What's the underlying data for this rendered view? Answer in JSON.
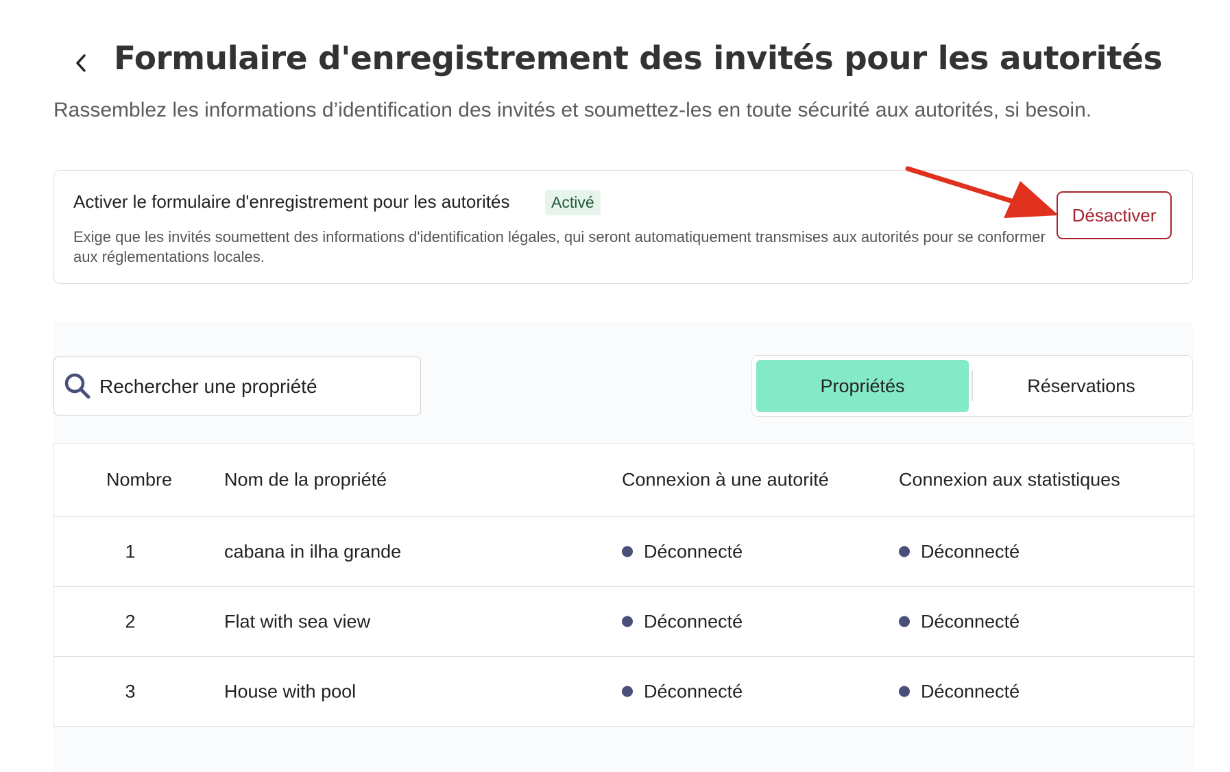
{
  "header": {
    "back_icon": "chevron-left-icon",
    "title": "Formulaire d'enregistrement des invités pour les autorités",
    "subtitle": "Rassemblez les informations d’identification des invités et soumettez-les en toute sécurité aux autorités, si besoin."
  },
  "activation": {
    "title": "Activer le formulaire d'enregistrement pour les autorités",
    "status": "Activé",
    "description": "Exige que les invités soumettent des informations d'identification légales, qui seront automatiquement transmises aux autorités pour se conformer aux réglementations locales.",
    "deactivate_label": "Désactiver"
  },
  "colors": {
    "active_tab": "#84e9c6",
    "danger": "#a8232d",
    "status_badge_bg": "#e7f4ec",
    "disconnected_dot": "#4a4f7a",
    "annotation_arrow": "#e0301e"
  },
  "search": {
    "icon": "search-icon",
    "placeholder": "Rechercher une propriété"
  },
  "tabs": {
    "properties": "Propriétés",
    "reservations": "Réservations",
    "selected": "Propriétés"
  },
  "table": {
    "headers": {
      "number": "Nombre",
      "name": "Nom de la propriété",
      "authority": "Connexion à une autorité",
      "statistics": "Connexion aux statistiques"
    },
    "rows": [
      {
        "number": "1",
        "name": "cabana in ilha grande",
        "authority": "Déconnecté",
        "statistics": "Déconnecté"
      },
      {
        "number": "2",
        "name": "Flat with sea view",
        "authority": "Déconnecté",
        "statistics": "Déconnecté"
      },
      {
        "number": "3",
        "name": "House with pool",
        "authority": "Déconnecté",
        "statistics": "Déconnecté"
      }
    ]
  }
}
